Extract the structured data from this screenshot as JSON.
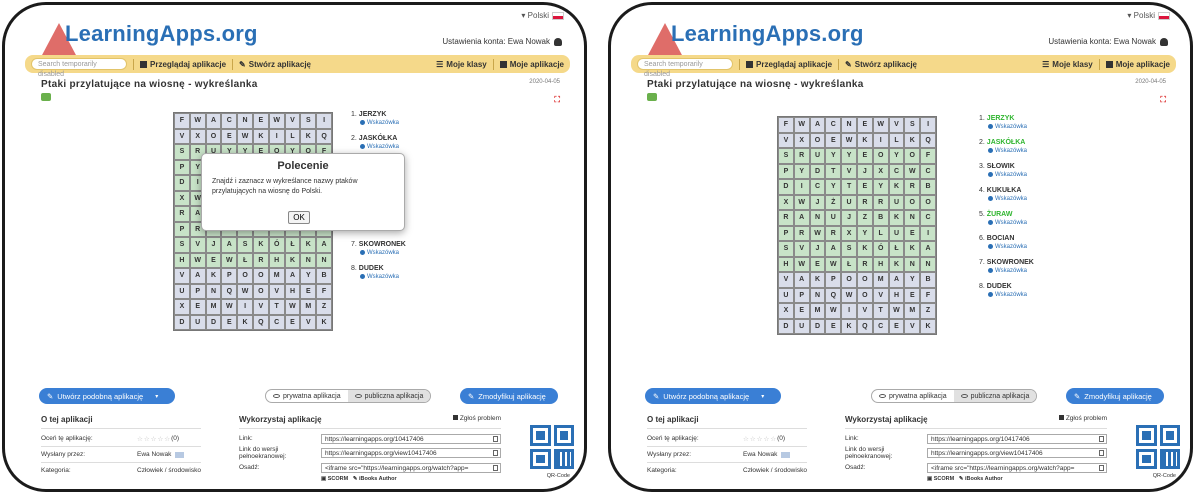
{
  "colors": {
    "accent": "#3a7fd5",
    "toolbar": "#f5d98a",
    "found_word": "#2fb52f",
    "grid_cell": "#d9ddea"
  },
  "header": {
    "logo": "LearningApps.org",
    "language": "Polski",
    "account": "Ustawienia konta: Ewa Nowak"
  },
  "toolbar": {
    "search_placeholder": "Search temporarily disabled",
    "browse": "Przeglądaj aplikacje",
    "create": "Stwórz aplikację",
    "classes": "Moje klasy",
    "my_apps": "Moje aplikacje"
  },
  "page": {
    "title": "Ptaki przylatujące na wiosnę - wykreślanka",
    "date": "2020-04-05"
  },
  "grid": [
    [
      "F",
      "W",
      "A",
      "C",
      "N",
      "E",
      "W",
      "V",
      "S",
      "I"
    ],
    [
      "V",
      "X",
      "O",
      "E",
      "W",
      "K",
      "I",
      "L",
      "K",
      "Q"
    ],
    [
      "S",
      "R",
      "U",
      "Y",
      "Y",
      "E",
      "O",
      "Y",
      "O",
      "F"
    ],
    [
      "P",
      "Y",
      "D",
      "T",
      "V",
      "J",
      "X",
      "C",
      "W",
      "C"
    ],
    [
      "D",
      "I",
      "C",
      "Y",
      "T",
      "E",
      "Y",
      "K",
      "R",
      "B"
    ],
    [
      "X",
      "W",
      "J",
      "Ż",
      "U",
      "R",
      "R",
      "U",
      "O",
      "O"
    ],
    [
      "R",
      "A",
      "N",
      "U",
      "J",
      "Z",
      "B",
      "K",
      "N",
      "C"
    ],
    [
      "P",
      "R",
      "W",
      "R",
      "X",
      "Y",
      "L",
      "U",
      "E",
      "I"
    ],
    [
      "S",
      "V",
      "J",
      "A",
      "S",
      "K",
      "Ó",
      "Ł",
      "K",
      "A"
    ],
    [
      "H",
      "W",
      "E",
      "W",
      "Ł",
      "R",
      "H",
      "K",
      "N",
      "N"
    ],
    [
      "V",
      "A",
      "K",
      "P",
      "O",
      "O",
      "M",
      "A",
      "Y",
      "B"
    ],
    [
      "U",
      "P",
      "N",
      "Q",
      "W",
      "O",
      "V",
      "H",
      "E",
      "F"
    ],
    [
      "X",
      "E",
      "M",
      "W",
      "I",
      "V",
      "T",
      "W",
      "M",
      "Z"
    ],
    [
      "D",
      "U",
      "D",
      "E",
      "K",
      "Q",
      "C",
      "E",
      "V",
      "K"
    ]
  ],
  "hint_label": "Wskazówka",
  "left_words": [
    {
      "n": "1.",
      "name": "JERZYK"
    },
    {
      "n": "2.",
      "name": "JASKÓŁKA"
    },
    {
      "n": "6.",
      "name": "BOCIAN"
    },
    {
      "n": "7.",
      "name": "SKOWRONEK"
    },
    {
      "n": "8.",
      "name": "DUDEK"
    }
  ],
  "right_words": [
    {
      "n": "1.",
      "name": "JERZYK",
      "found": true
    },
    {
      "n": "2.",
      "name": "JASKÓŁKA",
      "found": true
    },
    {
      "n": "3.",
      "name": "SŁOWIK",
      "found": false
    },
    {
      "n": "4.",
      "name": "KUKUŁKA",
      "found": false
    },
    {
      "n": "5.",
      "name": "ŻURAW",
      "found": true
    },
    {
      "n": "6.",
      "name": "BOCIAN",
      "found": false
    },
    {
      "n": "7.",
      "name": "SKOWRONEK",
      "found": false
    },
    {
      "n": "8.",
      "name": "DUDEK",
      "found": false
    }
  ],
  "dialog": {
    "title": "Polecenie",
    "body": "Znajdź i zaznacz w wykreślance nazwy ptaków przylatujących na wiosnę do Polski.",
    "ok": "OK"
  },
  "actions": {
    "create_similar": "Utwórz podobną aplikację",
    "private": "prywatna aplikacja",
    "public": "publiczna aplikacja",
    "modify": "Zmodyfikuj aplikację"
  },
  "info": {
    "about_title": "O tej aplikacji",
    "rate_label": "Oceń tę aplikację:",
    "rate_value": "(0)",
    "author_label": "Wysłany przez:",
    "author": "Ewa Nowak",
    "category_label": "Kategoria:",
    "category": "Człowiek / środowisko",
    "use_title": "Wykorzystaj aplikację",
    "report": "Zgłoś problem",
    "link_label": "Link:",
    "link": "https://learningapps.org/10417406",
    "fullscreen_label": "Link do wersji pełnoekranowej:",
    "fullscreen_link": "https://learningapps.org/view10417406",
    "embed_label": "Osadź:",
    "embed": "<iframe src=\"https://learningapps.org/watch?app=",
    "scorm": "SCORM",
    "ibooks": "iBooks Author",
    "qr_label": "QR-Code"
  }
}
